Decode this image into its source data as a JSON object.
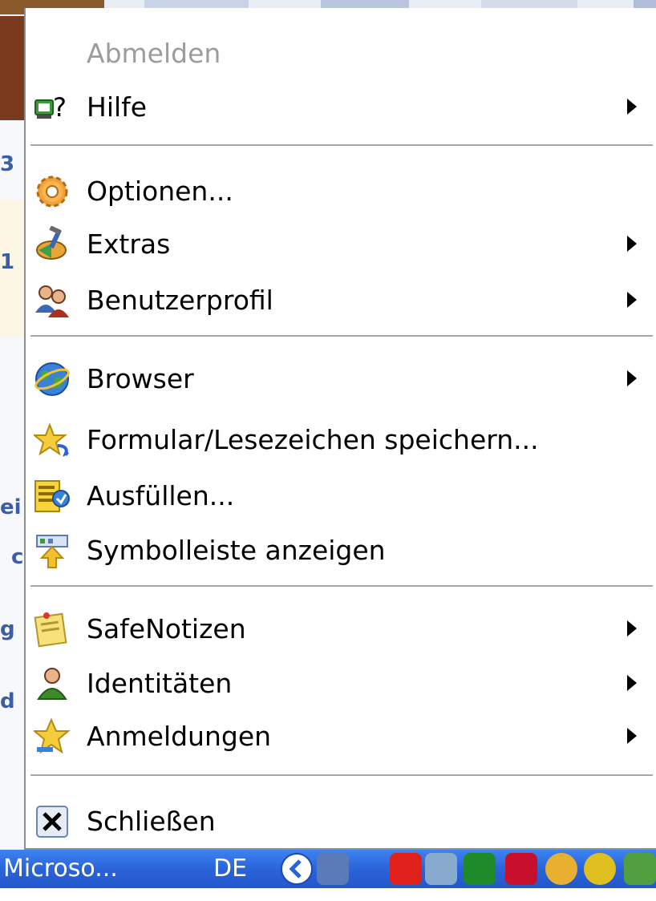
{
  "menu": {
    "items": [
      {
        "label": "Abmelden",
        "disabled": true,
        "submenu": false,
        "icon": "none"
      },
      {
        "label": "Hilfe",
        "disabled": false,
        "submenu": true,
        "icon": "help-icon"
      },
      {
        "label": "Optionen...",
        "disabled": false,
        "submenu": false,
        "icon": "gear-icon"
      },
      {
        "label": "Extras",
        "disabled": false,
        "submenu": true,
        "icon": "tools-icon"
      },
      {
        "label": "Benutzerprofil",
        "disabled": false,
        "submenu": true,
        "icon": "users-icon"
      },
      {
        "label": "Browser",
        "disabled": false,
        "submenu": true,
        "icon": "globe-icon"
      },
      {
        "label": "Formular/Lesezeichen speichern...",
        "disabled": false,
        "submenu": false,
        "icon": "star-save-icon"
      },
      {
        "label": "Ausfüllen...",
        "disabled": false,
        "submenu": false,
        "icon": "fill-form-icon"
      },
      {
        "label": "Symbolleiste anzeigen",
        "disabled": false,
        "submenu": false,
        "icon": "toolbar-icon"
      },
      {
        "label": "SafeNotizen",
        "disabled": false,
        "submenu": true,
        "icon": "notes-icon"
      },
      {
        "label": "Identitäten",
        "disabled": false,
        "submenu": true,
        "icon": "identity-icon"
      },
      {
        "label": "Anmeldungen",
        "disabled": false,
        "submenu": true,
        "icon": "star-login-icon"
      },
      {
        "label": "Schließen",
        "disabled": false,
        "submenu": false,
        "icon": "close-icon"
      }
    ]
  },
  "taskbar": {
    "window_button": "Microso...",
    "language": "DE"
  },
  "background": {
    "left_strip_chars": [
      "3",
      "1",
      "ei",
      "c",
      "g",
      "d"
    ]
  },
  "colors": {
    "taskbar": "#2a62d8",
    "disabled_text": "#9c9c9c"
  }
}
